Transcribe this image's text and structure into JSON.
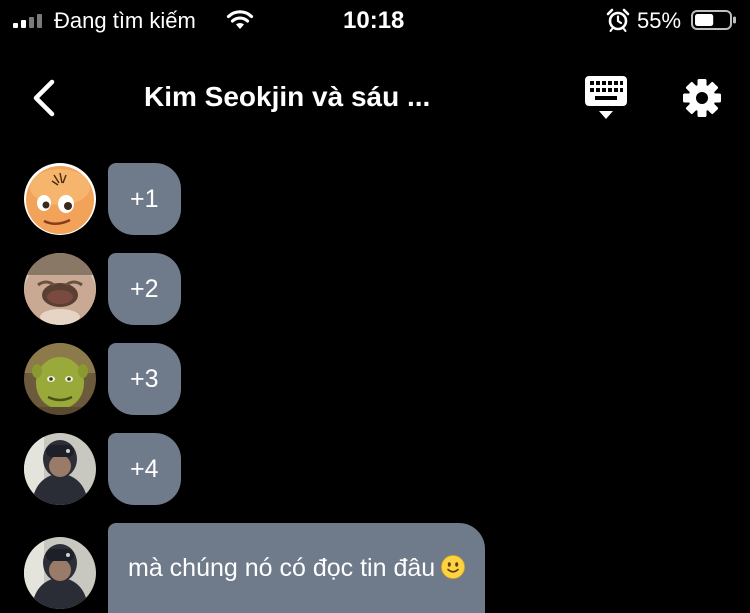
{
  "status_bar": {
    "carrier": "Đang tìm kiếm",
    "time": "10:18",
    "battery_percent": "55%",
    "battery_level": 0.55,
    "icons": [
      "signal-icon",
      "wifi-icon",
      "alarm-icon",
      "battery-icon"
    ]
  },
  "nav": {
    "title": "Kim Seokjin và sáu ...",
    "icons": [
      "back-icon",
      "keyboard-icon",
      "gear-icon"
    ]
  },
  "messages": [
    {
      "text": "+1",
      "avatar": "cartoon-face-avatar"
    },
    {
      "text": "+2",
      "avatar": "crying-face-avatar"
    },
    {
      "text": "+3",
      "avatar": "shrek-avatar"
    },
    {
      "text": "+4",
      "avatar": "person-hood-avatar"
    },
    {
      "text": "mà chúng nó có đọc tin đâu",
      "emoji": "slightly-smiling-face-emoji",
      "avatar": "person-hood-avatar"
    }
  ],
  "colors": {
    "background": "#000000",
    "bubble": "#6f7b8b",
    "text": "#ffffff"
  }
}
